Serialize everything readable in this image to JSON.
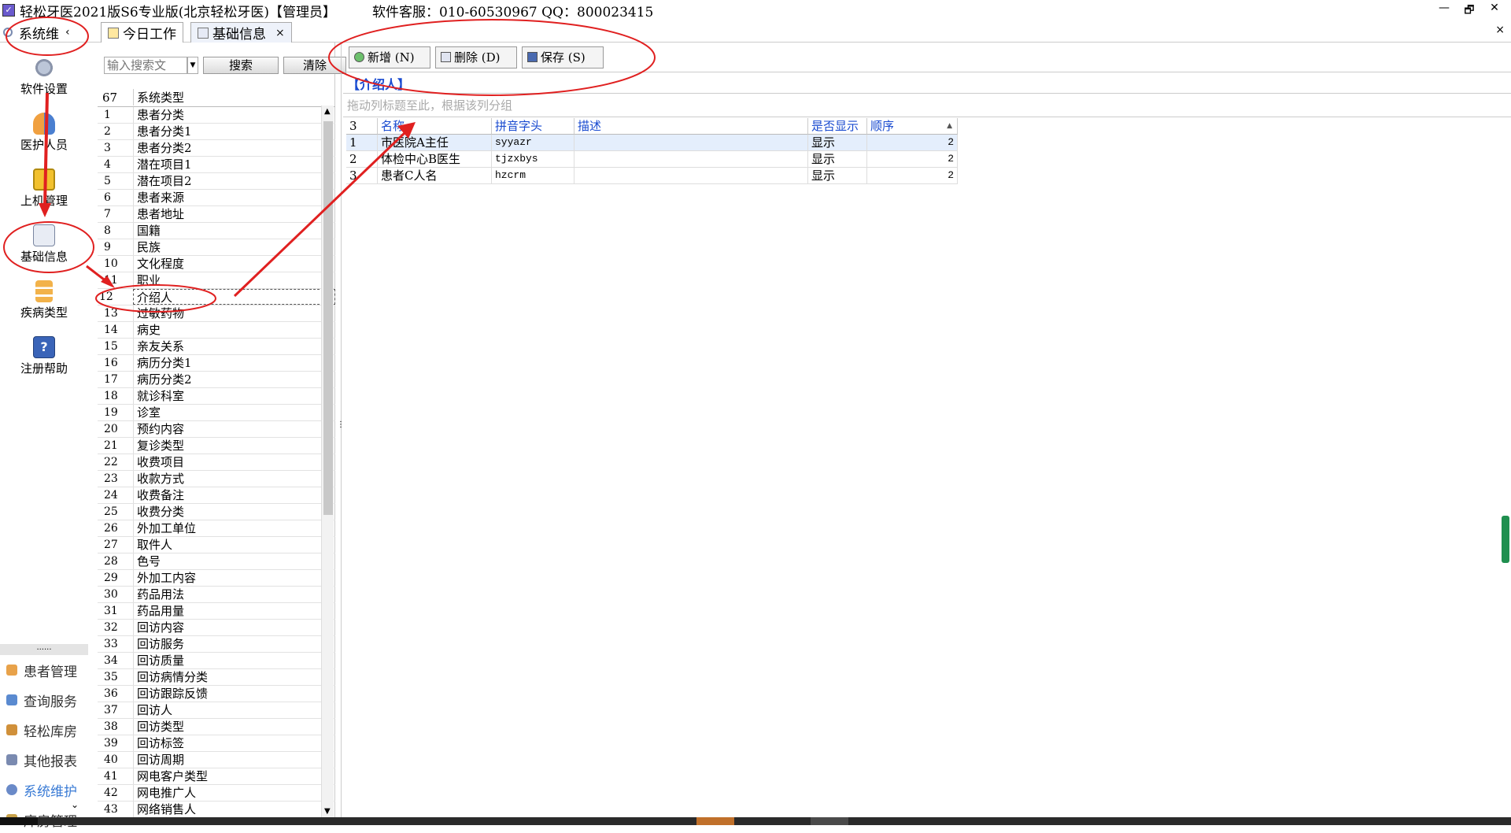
{
  "window": {
    "title": "轻松牙医2021版S6专业版(北京轻松牙医)【管理员】",
    "service": "软件客服：010-60530967 QQ：800023415",
    "buttons": {
      "min": "—",
      "restore": "🗗",
      "close": "✕"
    }
  },
  "sidebar": {
    "header": "系统维",
    "header_chevron": "‹",
    "buttons": [
      {
        "label": "软件设置",
        "icon": "gear-icon"
      },
      {
        "label": "医护人员",
        "icon": "users-icon"
      },
      {
        "label": "上机管理",
        "icon": "lock-icon"
      },
      {
        "label": "基础信息",
        "icon": "settings-doc-icon"
      },
      {
        "label": "疾病类型",
        "icon": "tree-icon"
      },
      {
        "label": "注册帮助",
        "icon": "help-icon"
      }
    ],
    "dots": "......",
    "nav": [
      {
        "label": "患者管理",
        "icon": "patients-icon",
        "active": false
      },
      {
        "label": "查询服务",
        "icon": "query-icon",
        "active": false
      },
      {
        "label": "轻松库房",
        "icon": "warehouse-icon",
        "active": false
      },
      {
        "label": "其他报表",
        "icon": "report-icon",
        "active": false
      },
      {
        "label": "系统维护",
        "icon": "maintenance-icon",
        "active": true
      },
      {
        "label": "库房管理",
        "icon": "store-icon",
        "active": false
      }
    ],
    "more": "⌄"
  },
  "tabs": [
    {
      "label": "今日工作",
      "active": false
    },
    {
      "label": "基础信息",
      "active": true,
      "close": "×"
    }
  ],
  "tabs_close": "×",
  "search": {
    "placeholder": "输入搜索文",
    "search_label": "搜索",
    "clear_label": "清除"
  },
  "type_grid": {
    "count": "67",
    "header": "系统类型",
    "rows": [
      [
        "1",
        "患者分类"
      ],
      [
        "2",
        "患者分类1"
      ],
      [
        "3",
        "患者分类2"
      ],
      [
        "4",
        "潜在项目1"
      ],
      [
        "5",
        "潜在项目2"
      ],
      [
        "6",
        "患者来源"
      ],
      [
        "7",
        "患者地址"
      ],
      [
        "8",
        "国籍"
      ],
      [
        "9",
        "民族"
      ],
      [
        "10",
        "文化程度"
      ],
      [
        "11",
        "职业"
      ],
      [
        "12",
        "介绍人"
      ],
      [
        "13",
        "过敏药物"
      ],
      [
        "14",
        "病史"
      ],
      [
        "15",
        "亲友关系"
      ],
      [
        "16",
        "病历分类1"
      ],
      [
        "17",
        "病历分类2"
      ],
      [
        "18",
        "就诊科室"
      ],
      [
        "19",
        "诊室"
      ],
      [
        "20",
        "预约内容"
      ],
      [
        "21",
        "复诊类型"
      ],
      [
        "22",
        "收费项目"
      ],
      [
        "23",
        "收款方式"
      ],
      [
        "24",
        "收费备注"
      ],
      [
        "25",
        "收费分类"
      ],
      [
        "26",
        "外加工单位"
      ],
      [
        "27",
        "取件人"
      ],
      [
        "28",
        "色号"
      ],
      [
        "29",
        "外加工内容"
      ],
      [
        "30",
        "药品用法"
      ],
      [
        "31",
        "药品用量"
      ],
      [
        "32",
        "回访内容"
      ],
      [
        "33",
        "回访服务"
      ],
      [
        "34",
        "回访质量"
      ],
      [
        "35",
        "回访病情分类"
      ],
      [
        "36",
        "回访跟踪反馈"
      ],
      [
        "37",
        "回访人"
      ],
      [
        "38",
        "回访类型"
      ],
      [
        "39",
        "回访标签"
      ],
      [
        "40",
        "回访周期"
      ],
      [
        "41",
        "网电客户类型"
      ],
      [
        "42",
        "网电推广人"
      ],
      [
        "43",
        "网络销售人"
      ]
    ],
    "selected_index": 11
  },
  "toolbar": {
    "new_label": "新增 (N)",
    "delete_label": "删除 (D)",
    "save_label": "保存 (S)"
  },
  "section": {
    "title": "【介绍人】",
    "group_hint": "拖动列标题至此，根据该列分组"
  },
  "detail_grid": {
    "count": "3",
    "columns": [
      "名称",
      "拼音字头",
      "描述",
      "是否显示",
      "顺序"
    ],
    "sort_arrow": "▲",
    "rows": [
      [
        "1",
        "市医院A主任",
        "syyazr",
        "",
        "显示",
        "2"
      ],
      [
        "2",
        "体检中心B医生",
        "tjzxbys",
        "",
        "显示",
        "2"
      ],
      [
        "3",
        "患者C人名",
        "hzcrm",
        "",
        "显示",
        "2"
      ]
    ]
  },
  "colors": {
    "accent_blue": "#1a4bd0",
    "annotation_red": "#e02020",
    "active_nav": "#3a7bd5"
  }
}
